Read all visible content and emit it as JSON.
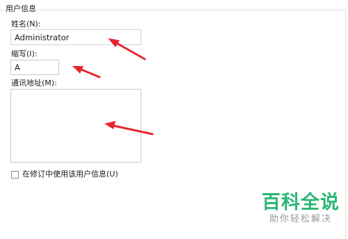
{
  "group": {
    "title": "用户信息"
  },
  "fields": {
    "name": {
      "label": "姓名(N):",
      "value": "Administrator"
    },
    "initials": {
      "label": "缩写(I):",
      "value": "A"
    },
    "address": {
      "label": "通讯地址(M):",
      "value": ""
    }
  },
  "options": {
    "always_use_label": "在修订中使用该用户信息(U)",
    "always_use_checked": false
  },
  "annotations": {
    "arrow_color": "#e8262c"
  },
  "watermark": {
    "title": "百科全说",
    "subtitle": "助你轻松解决",
    "color": "#2bb673"
  }
}
